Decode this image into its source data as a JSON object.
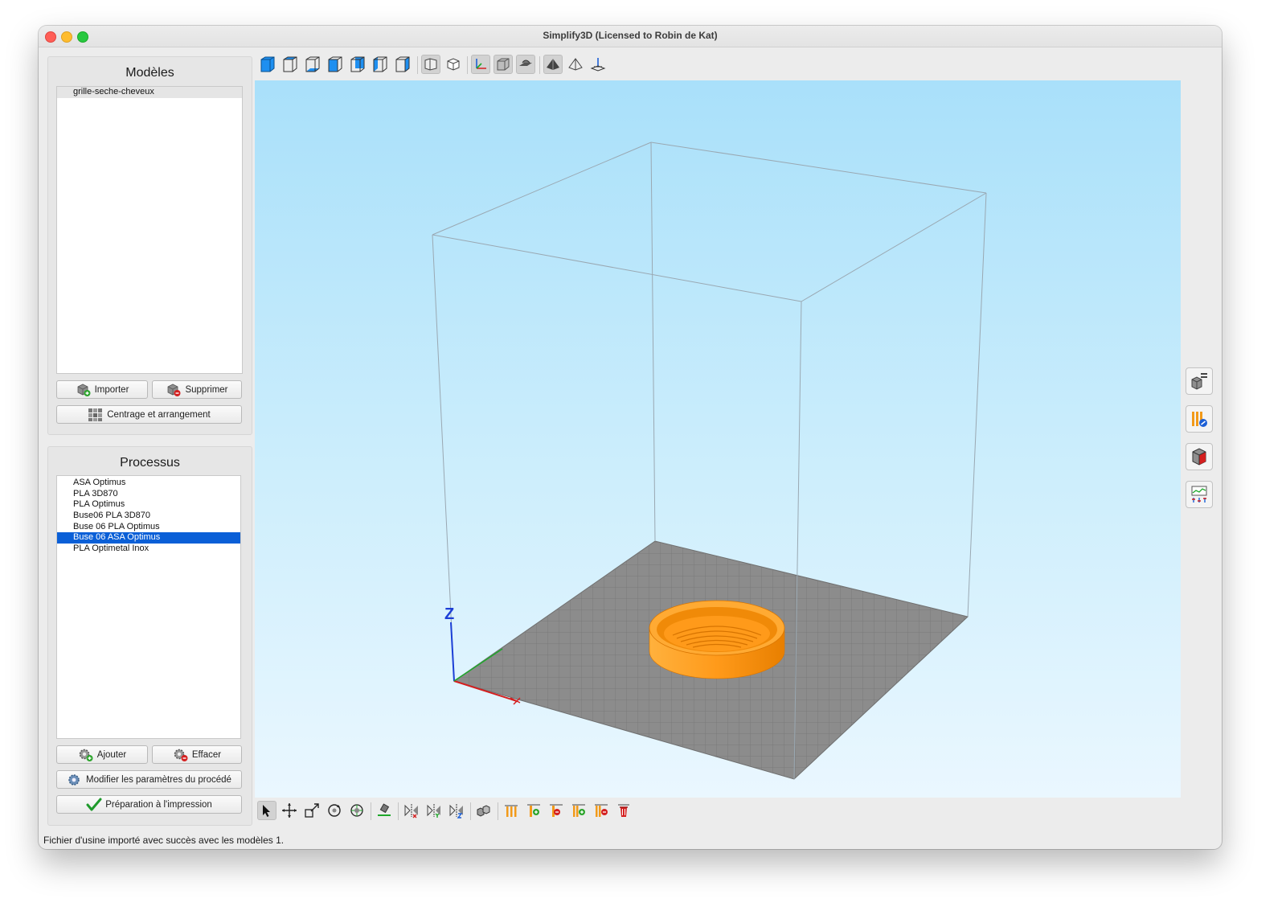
{
  "window": {
    "title": "Simplify3D (Licensed to Robin  de Kat)"
  },
  "models_panel": {
    "title": "Modèles",
    "items": [
      "grille-seche-cheveux"
    ],
    "import_label": "Importer",
    "delete_label": "Supprimer",
    "arrange_label": "Centrage et arrangement"
  },
  "process_panel": {
    "title": "Processus",
    "items": [
      "ASA Optimus",
      "PLA 3D870",
      "PLA Optimus",
      "Buse06 PLA 3D870",
      "Buse 06 PLA Optimus",
      "Buse 06 ASA Optimus",
      "PLA Optimetal Inox"
    ],
    "selected": "Buse 06 ASA Optimus",
    "add_label": "Ajouter",
    "erase_label": "Effacer",
    "edit_label": "Modifier les paramètres du procédé",
    "prepare_label": "Préparation à l'impression"
  },
  "viewport": {
    "axis_z": "Z",
    "model_color": "#ff9a1a",
    "bed_color": "#8c8c8c",
    "background_top": "#a9e0fa",
    "background_bottom": "#eaf7ff"
  },
  "statusbar": {
    "text": "Fichier d'usine importé avec succès avec les modèles 1."
  }
}
